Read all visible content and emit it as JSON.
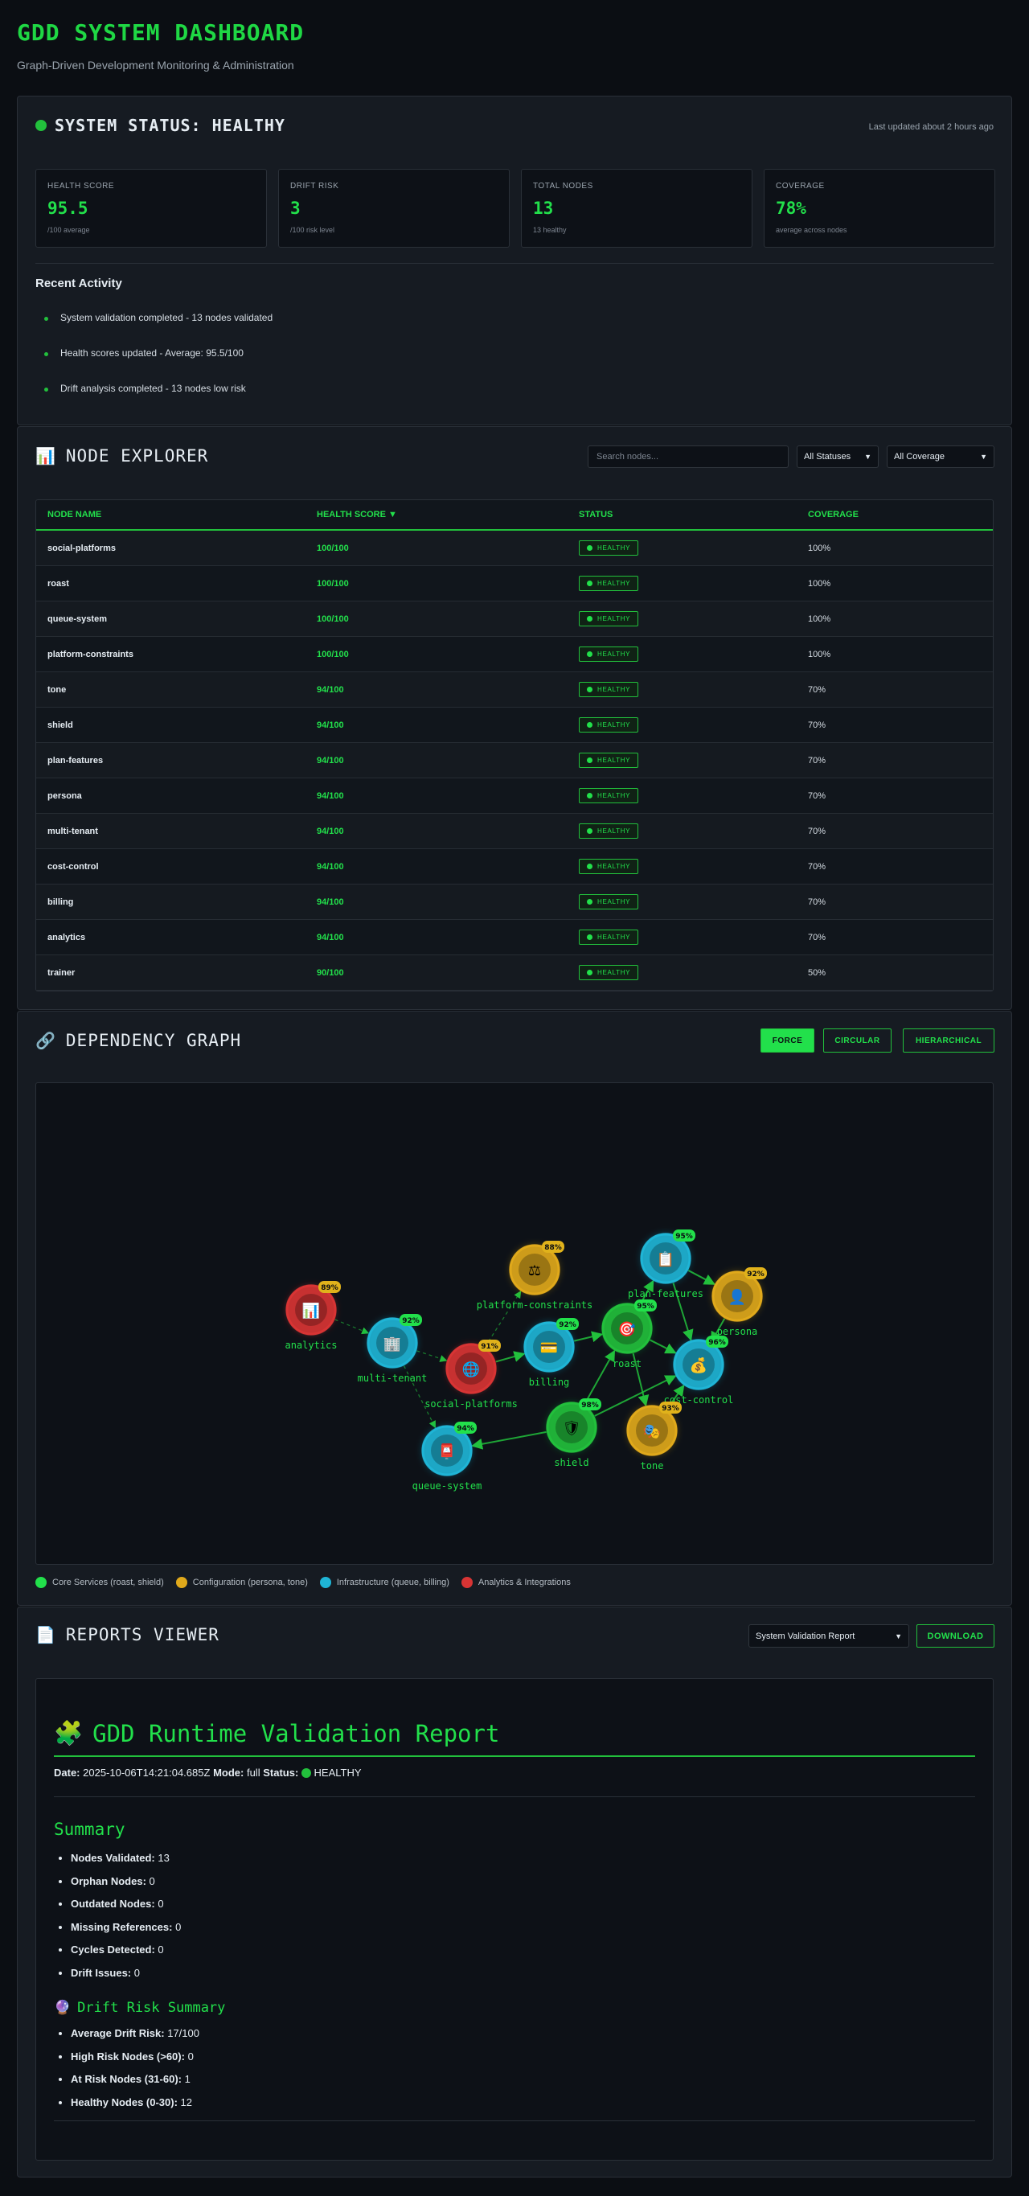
{
  "header": {
    "title": "GDD SYSTEM DASHBOARD",
    "subtitle": "Graph-Driven Development Monitoring & Administration"
  },
  "status": {
    "title": "SYSTEM STATUS: HEALTHY",
    "updated": "Last updated about 2 hours ago",
    "metrics": [
      {
        "label": "HEALTH SCORE",
        "value": "95.5",
        "sub": "/100 average"
      },
      {
        "label": "DRIFT RISK",
        "value": "3",
        "sub": "/100 risk level"
      },
      {
        "label": "TOTAL NODES",
        "value": "13",
        "sub": "13 healthy"
      },
      {
        "label": "COVERAGE",
        "value": "78%",
        "sub": "average across nodes"
      }
    ],
    "activity_title": "Recent Activity",
    "activity": [
      "System validation completed - 13 nodes validated",
      "Health scores updated - Average: 95.5/100",
      "Drift analysis completed - 13 nodes low risk"
    ]
  },
  "explorer": {
    "icon": "📊",
    "title": "NODE EXPLORER",
    "search_placeholder": "Search nodes...",
    "status_filter": "All Statuses",
    "coverage_filter": "All Coverage",
    "columns": [
      "NODE NAME",
      "HEALTH SCORE ▼",
      "STATUS",
      "COVERAGE"
    ],
    "rows": [
      {
        "name": "social-platforms",
        "score": "100/100",
        "status": "HEALTHY",
        "coverage": "100%"
      },
      {
        "name": "roast",
        "score": "100/100",
        "status": "HEALTHY",
        "coverage": "100%"
      },
      {
        "name": "queue-system",
        "score": "100/100",
        "status": "HEALTHY",
        "coverage": "100%"
      },
      {
        "name": "platform-constraints",
        "score": "100/100",
        "status": "HEALTHY",
        "coverage": "100%"
      },
      {
        "name": "tone",
        "score": "94/100",
        "status": "HEALTHY",
        "coverage": "70%"
      },
      {
        "name": "shield",
        "score": "94/100",
        "status": "HEALTHY",
        "coverage": "70%"
      },
      {
        "name": "plan-features",
        "score": "94/100",
        "status": "HEALTHY",
        "coverage": "70%"
      },
      {
        "name": "persona",
        "score": "94/100",
        "status": "HEALTHY",
        "coverage": "70%"
      },
      {
        "name": "multi-tenant",
        "score": "94/100",
        "status": "HEALTHY",
        "coverage": "70%"
      },
      {
        "name": "cost-control",
        "score": "94/100",
        "status": "HEALTHY",
        "coverage": "70%"
      },
      {
        "name": "billing",
        "score": "94/100",
        "status": "HEALTHY",
        "coverage": "70%"
      },
      {
        "name": "analytics",
        "score": "94/100",
        "status": "HEALTHY",
        "coverage": "70%"
      },
      {
        "name": "trainer",
        "score": "90/100",
        "status": "HEALTHY",
        "coverage": "50%"
      }
    ]
  },
  "graph": {
    "icon": "🔗",
    "title": "DEPENDENCY GRAPH",
    "buttons": [
      "FORCE",
      "CIRCULAR",
      "HIERARCHICAL"
    ],
    "colors": {
      "core": "#22c03c",
      "config": "#e0a91b",
      "infra": "#1fb5d6",
      "analytics": "#d83434"
    },
    "nodes": [
      {
        "id": "analytics",
        "label": "analytics",
        "badge": "89%",
        "group": "analytics",
        "icon": "📊"
      },
      {
        "id": "multi-tenant",
        "label": "multi-tenant",
        "badge": "92%",
        "group": "infra",
        "icon": "🏢"
      },
      {
        "id": "social-platforms",
        "label": "social-platforms",
        "badge": "91%",
        "group": "analytics",
        "icon": "🌐"
      },
      {
        "id": "platform-constraints",
        "label": "platform-constraints",
        "badge": "88%",
        "group": "config",
        "icon": "⚖"
      },
      {
        "id": "billing",
        "label": "billing",
        "badge": "92%",
        "group": "infra",
        "icon": "💳"
      },
      {
        "id": "roast",
        "label": "roast",
        "badge": "95%",
        "group": "core",
        "icon": "🎯"
      },
      {
        "id": "plan-features",
        "label": "plan-features",
        "badge": "95%",
        "group": "infra",
        "icon": "📋"
      },
      {
        "id": "persona",
        "label": "persona",
        "badge": "92%",
        "group": "config",
        "icon": "👤"
      },
      {
        "id": "cost-control",
        "label": "cost-control",
        "badge": "96%",
        "group": "infra",
        "icon": "💰"
      },
      {
        "id": "shield",
        "label": "shield",
        "badge": "98%",
        "group": "core",
        "icon": "🛡"
      },
      {
        "id": "tone",
        "label": "tone",
        "badge": "93%",
        "group": "config",
        "icon": "🎭"
      },
      {
        "id": "queue-system",
        "label": "queue-system",
        "badge": "94%",
        "group": "infra",
        "icon": "📮"
      }
    ],
    "legend": [
      {
        "label": "Core Services (roast, shield)",
        "color": "#22c03c"
      },
      {
        "label": "Configuration (persona, tone)",
        "color": "#e0a91b"
      },
      {
        "label": "Infrastructure (queue, billing)",
        "color": "#1fb5d6"
      },
      {
        "label": "Analytics & Integrations",
        "color": "#d83434"
      }
    ]
  },
  "reports": {
    "icon": "📄",
    "title": "REPORTS VIEWER",
    "selected": "System Validation Report",
    "download": "DOWNLOAD",
    "doc": {
      "icon": "🧩",
      "title": "GDD Runtime Validation Report",
      "date_label": "Date:",
      "date": "2025-10-06T14:21:04.685Z",
      "mode_label": "Mode:",
      "mode": "full",
      "status_label": "Status:",
      "status": "HEALTHY",
      "summary_title": "Summary",
      "summary": [
        {
          "k": "Nodes Validated:",
          "v": "13"
        },
        {
          "k": "Orphan Nodes:",
          "v": "0"
        },
        {
          "k": "Outdated Nodes:",
          "v": "0"
        },
        {
          "k": "Missing References:",
          "v": "0"
        },
        {
          "k": "Cycles Detected:",
          "v": "0"
        },
        {
          "k": "Drift Issues:",
          "v": "0"
        }
      ],
      "drift_icon": "🔮",
      "drift_title": "Drift Risk Summary",
      "drift": [
        {
          "k": "Average Drift Risk:",
          "v": "17/100"
        },
        {
          "k": "High Risk Nodes (>60):",
          "v": "0"
        },
        {
          "k": "At Risk Nodes (31-60):",
          "v": "1"
        },
        {
          "k": "Healthy Nodes (0-30):",
          "v": "12"
        }
      ]
    }
  }
}
